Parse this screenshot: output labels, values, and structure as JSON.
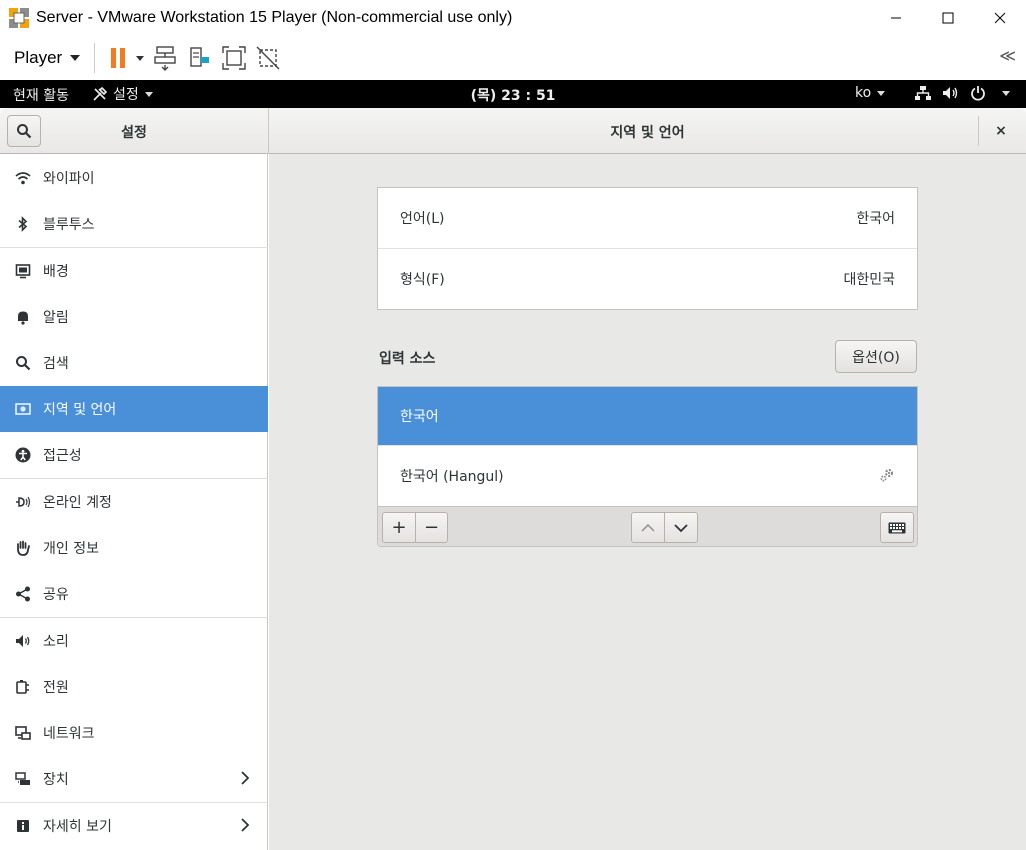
{
  "window": {
    "title": "Server - VMware Workstation 15 Player (Non-commercial use only)"
  },
  "vm_toolbar": {
    "player_label": "Player",
    "collapse_glyph": "≪"
  },
  "topbar": {
    "activities": "현재 활동",
    "app_menu": "설정",
    "clock": "(목) 23 : 51",
    "input_lang": "ko"
  },
  "header": {
    "sidebar_title": "설정",
    "page_title": "지역 및 언어",
    "close_glyph": "×"
  },
  "sidebar": {
    "items": [
      {
        "label": "와이파이",
        "icon": "wifi-icon"
      },
      {
        "label": "블루투스",
        "icon": "bluetooth-icon"
      },
      {
        "label": "배경",
        "icon": "background-icon"
      },
      {
        "label": "알림",
        "icon": "bell-icon"
      },
      {
        "label": "검색",
        "icon": "search-icon"
      },
      {
        "label": "지역 및 언어",
        "icon": "flag-icon",
        "active": true
      },
      {
        "label": "접근성",
        "icon": "accessibility-icon"
      },
      {
        "label": "온라인 계정",
        "icon": "online-accounts-icon"
      },
      {
        "label": "개인 정보",
        "icon": "privacy-hand-icon"
      },
      {
        "label": "공유",
        "icon": "share-icon"
      },
      {
        "label": "소리",
        "icon": "sound-icon"
      },
      {
        "label": "전원",
        "icon": "power-plug-icon"
      },
      {
        "label": "네트워크",
        "icon": "network-icon"
      },
      {
        "label": "장치",
        "icon": "devices-icon"
      },
      {
        "label": "자세히 보기",
        "icon": "info-icon"
      }
    ]
  },
  "region": {
    "language_label": "언어(L)",
    "language_value": "한국어",
    "formats_label": "형식(F)",
    "formats_value": "대한민국"
  },
  "input_sources": {
    "heading": "입력 소스",
    "options_label": "옵션(O)",
    "items": [
      "한국어",
      "한국어 (Hangul)"
    ],
    "add_glyph": "+",
    "remove_glyph": "−"
  },
  "colors": {
    "accent": "#4a90d9",
    "topbar_bg": "#000000",
    "content_bg": "#e8e8e7"
  }
}
